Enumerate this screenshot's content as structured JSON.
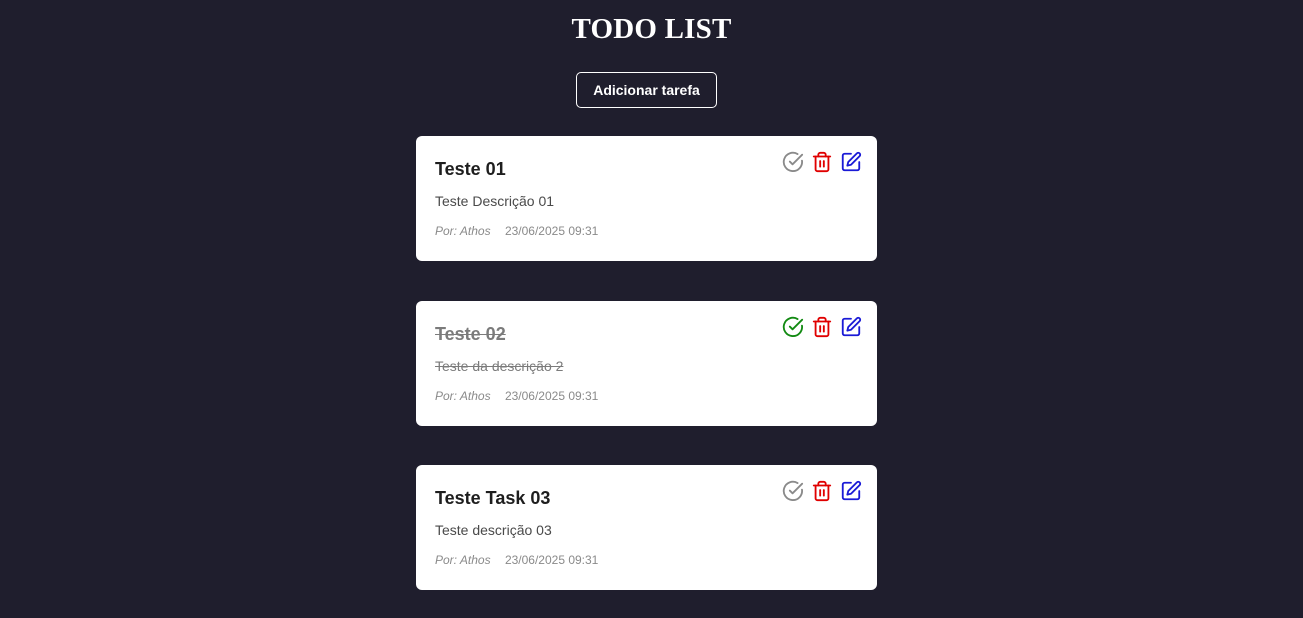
{
  "header": {
    "title": "TODO LIST"
  },
  "toolbar": {
    "add_label": "Adicionar tarefa"
  },
  "colors": {
    "background": "#1f1e2d",
    "check_pending": "#8a8a8a",
    "check_done": "#128a12",
    "delete": "#e00000",
    "edit": "#1a1ad6"
  },
  "tasks": [
    {
      "title": "Teste 01",
      "description": "Teste Descrição 01",
      "author": "Por: Athos",
      "date": "23/06/2025 09:31",
      "completed": false
    },
    {
      "title": "Teste 02",
      "description": "Teste da descrição 2",
      "author": "Por: Athos",
      "date": "23/06/2025 09:31",
      "completed": true
    },
    {
      "title": "Teste Task 03",
      "description": "Teste descrição 03",
      "author": "Por: Athos",
      "date": "23/06/2025 09:31",
      "completed": false
    }
  ]
}
